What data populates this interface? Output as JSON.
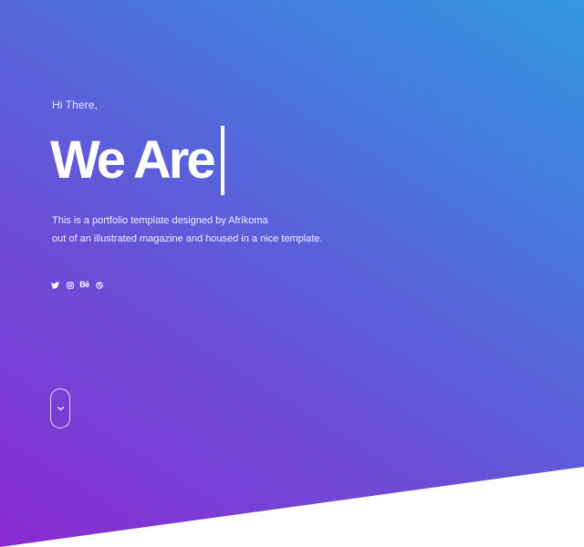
{
  "hero": {
    "greeting": "Hi There,",
    "headline": "We Are",
    "description_lines": [
      "This is a portfolio template designed by Afrikoma",
      "out of an illustrated magazine and housed in a nice template."
    ]
  },
  "socials": [
    {
      "icon": "twitter-icon"
    },
    {
      "icon": "instagram-icon"
    },
    {
      "icon": "behance-icon",
      "label": "Bē"
    },
    {
      "icon": "dribbble-icon"
    }
  ],
  "scroll": {
    "icon": "chevron-down-icon"
  },
  "colors": {
    "gradient_start": "#8a2bd2",
    "gradient_mid": "#6a4fd6",
    "gradient_end": "#3398e2",
    "text": "#ffffff",
    "background": "#ffffff"
  }
}
